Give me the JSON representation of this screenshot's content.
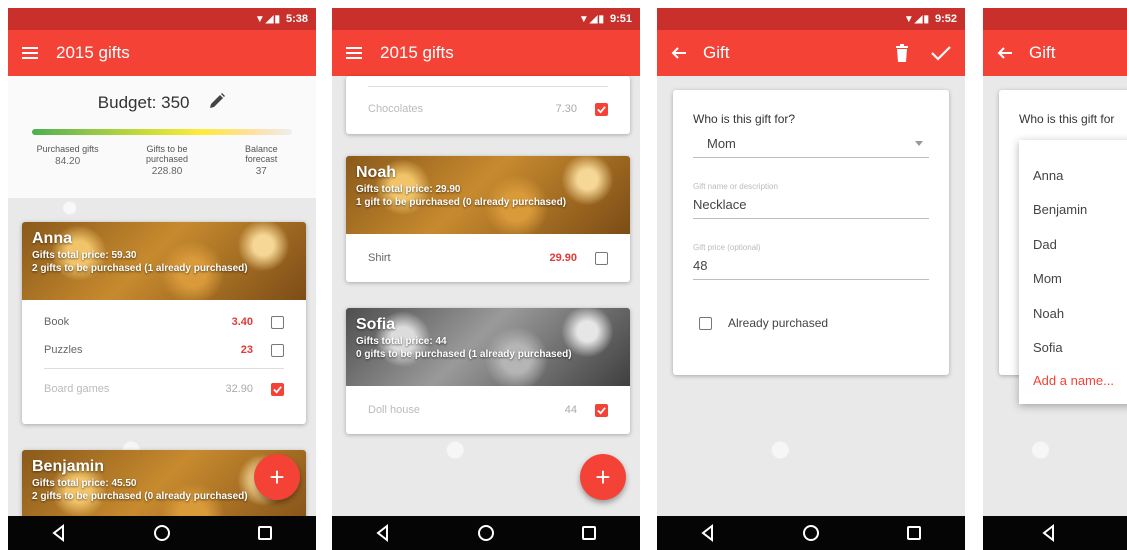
{
  "phone1": {
    "status_time": "5:38",
    "title": "2015 gifts",
    "budget_label": "Budget: 350",
    "stats": [
      {
        "label": "Purchased gifts",
        "value": "84.20"
      },
      {
        "label": "Gifts to be purchased",
        "value": "228.80"
      },
      {
        "label": "Balance forecast",
        "value": "37"
      }
    ],
    "cards": [
      {
        "name": "Anna",
        "total": "Gifts total price: 59.30",
        "summary": "2 gifts to be purchased (1 already purchased)",
        "items": [
          {
            "label": "Book",
            "price": "3.40"
          },
          {
            "label": "Puzzles",
            "price": "23"
          }
        ],
        "done_items": [
          {
            "label": "Board games",
            "price": "32.90"
          }
        ]
      },
      {
        "name": "Benjamin",
        "total": "Gifts total price: 45.50",
        "summary": "2 gifts to be purchased (0 already purchased)"
      }
    ],
    "fab": "+"
  },
  "phone2": {
    "status_time": "9:51",
    "title": "2015 gifts",
    "top_item": {
      "label": "Chocolates",
      "price": "7.30"
    },
    "cards": [
      {
        "name": "Noah",
        "total": "Gifts total price: 29.90",
        "summary": "1 gift to be purchased (0 already purchased)",
        "items": [
          {
            "label": "Shirt",
            "price": "29.90"
          }
        ]
      },
      {
        "name": "Sofia",
        "total": "Gifts total price: 44",
        "summary": "0 gifts to be purchased (1 already purchased)",
        "done_items": [
          {
            "label": "Doll house",
            "price": "44"
          }
        ]
      }
    ],
    "fab": "+"
  },
  "phone3": {
    "status_time": "9:52",
    "title": "Gift",
    "who_label": "Who is this gift for?",
    "who_value": "Mom",
    "name_label": "Gift name or description",
    "name_value": "Necklace",
    "price_label": "Gift price (optional)",
    "price_value": "48",
    "purchased_label": "Already purchased"
  },
  "phone4": {
    "title": "Gift",
    "who_label": "Who is this gift for",
    "options": [
      "Anna",
      "Benjamin",
      "Dad",
      "Mom",
      "Noah",
      "Sofia"
    ],
    "add_name": "Add a name..."
  },
  "colors": {
    "accent": "#f44336",
    "status": "#c9302c"
  }
}
